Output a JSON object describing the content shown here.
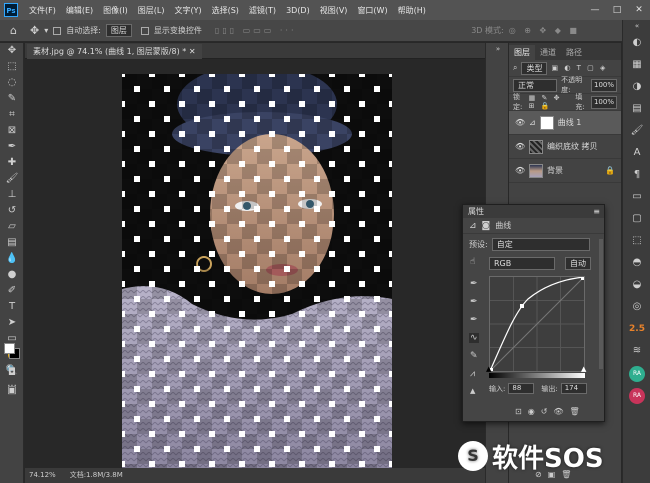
{
  "menubar": {
    "logo": "Ps",
    "items": [
      "文件(F)",
      "编辑(E)",
      "图像(I)",
      "图层(L)",
      "文字(Y)",
      "选择(S)",
      "滤镜(T)",
      "3D(D)",
      "视图(V)",
      "窗口(W)",
      "帮助(H)"
    ],
    "window_controls": [
      "—",
      "□",
      "✕"
    ]
  },
  "options": {
    "auto_select_label": "自动选择:",
    "auto_select_value": "图层",
    "show_transform_label": "显示变换控件",
    "mode_3d": "3D 模式:"
  },
  "document": {
    "tab_title": "素材.jpg @ 74.1% (曲线 1, 图层蒙版/8) *",
    "zoom": "74.12%",
    "doc_size": "文档:1.8M/3.8M"
  },
  "layers_panel": {
    "tabs": [
      "图层",
      "通道",
      "路径"
    ],
    "filter_label": "类型",
    "blend_mode": "正常",
    "opacity_label": "不透明度:",
    "opacity_value": "100%",
    "lock_label": "锁定:",
    "fill_label": "填充:",
    "fill_value": "100%",
    "layers": [
      {
        "name": "曲线 1",
        "selected": true
      },
      {
        "name": "编织底纹 拷贝",
        "selected": false
      },
      {
        "name": "背景",
        "selected": false
      }
    ]
  },
  "properties": {
    "title": "属性",
    "type_label": "曲线",
    "preset_label": "预设:",
    "preset_value": "自定",
    "channel": "RGB",
    "auto_button": "自动",
    "input_label": "输入:",
    "input_value": "88",
    "output_label": "输出:",
    "output_value": "174"
  },
  "right_dock_badge": "2.5",
  "right_dock_ra": "RA",
  "watermark": "软件SOS",
  "watermark_logo": "S",
  "colors": {
    "accent": "#31a8ff",
    "panel": "#434343",
    "canvas": "#282828"
  }
}
